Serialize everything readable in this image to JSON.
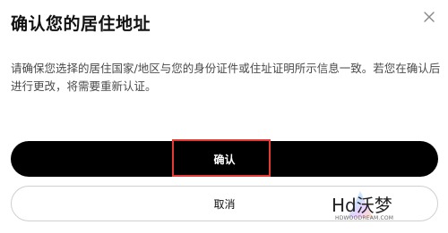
{
  "dialog": {
    "title": "确认您的居住地址",
    "description": "请确保您选择的居住国家/地区与您的身份证件或住址证明所示信息一致。若您在确认后进行更改，将需要重新认证。",
    "confirm_label": "确认",
    "cancel_label": "取消",
    "close_icon": "close-icon"
  },
  "watermark": {
    "text": "Hd沃梦",
    "subtext": "HDWOODREAM.COM"
  },
  "colors": {
    "primary_button": "#000000",
    "highlight": "#e53935"
  }
}
